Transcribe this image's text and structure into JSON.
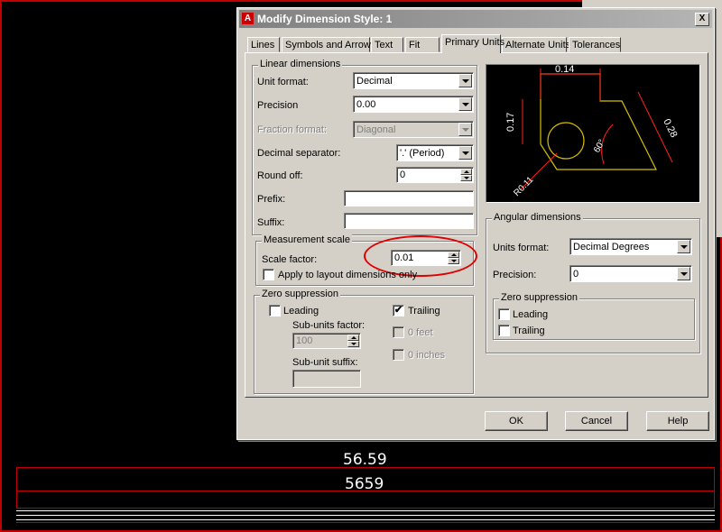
{
  "dialog": {
    "title": "Modify Dimension Style: 1",
    "close_glyph": "X",
    "app_icon_glyph": "A"
  },
  "tabs": [
    {
      "label": "Lines",
      "active": false
    },
    {
      "label": "Symbols and Arrows",
      "active": false
    },
    {
      "label": "Text",
      "active": false
    },
    {
      "label": "Fit",
      "active": false
    },
    {
      "label": "Primary Units",
      "active": true
    },
    {
      "label": "Alternate Units",
      "active": false
    },
    {
      "label": "Tolerances",
      "active": false
    }
  ],
  "linear": {
    "legend": "Linear dimensions",
    "unit_format_label": "Unit format:",
    "unit_format_value": "Decimal",
    "precision_label": "Precision",
    "precision_value": "0.00",
    "fraction_format_label": "Fraction format:",
    "fraction_format_value": "Diagonal",
    "decimal_separator_label": "Decimal separator:",
    "decimal_separator_value": "'.' (Period)",
    "round_off_label": "Round off:",
    "round_off_value": "0",
    "prefix_label": "Prefix:",
    "prefix_value": "",
    "suffix_label": "Suffix:",
    "suffix_value": ""
  },
  "measurement": {
    "legend": "Measurement scale",
    "scale_factor_label": "Scale factor:",
    "scale_factor_value": "0.01",
    "apply_layout_label": "Apply to layout dimensions only",
    "apply_layout_checked": false
  },
  "zero_suppression": {
    "legend": "Zero suppression",
    "leading_label": "Leading",
    "leading_checked": false,
    "trailing_label": "Trailing",
    "trailing_checked": true,
    "trailing_check_glyph": "✔",
    "subunits_factor_label": "Sub-units factor:",
    "subunits_factor_value": "100",
    "subunit_suffix_label": "Sub-unit suffix:",
    "subunit_suffix_value": "",
    "zero_feet_label": "0 feet",
    "zero_inches_label": "0 inches"
  },
  "preview": {
    "dim_top": "0.14",
    "dim_left": "0.17",
    "dim_right": "0.28",
    "dim_radius": "R0.11",
    "dim_angle": "60°"
  },
  "angular": {
    "legend": "Angular dimensions",
    "units_format_label": "Units format:",
    "units_format_value": "Decimal Degrees",
    "precision_label": "Precision:",
    "precision_value": "0",
    "zero_legend": "Zero suppression",
    "leading_label": "Leading",
    "leading_checked": false,
    "trailing_label": "Trailing",
    "trailing_checked": false
  },
  "buttons": {
    "ok": "OK",
    "cancel": "Cancel",
    "help": "Help"
  },
  "drawing": {
    "value_top": "56.59",
    "value_bottom": "5659"
  },
  "colors": {
    "annotation_red": "#e00000",
    "preview_yellow": "#d8c000",
    "preview_red": "#ff2020",
    "frame_red": "#c00000"
  }
}
